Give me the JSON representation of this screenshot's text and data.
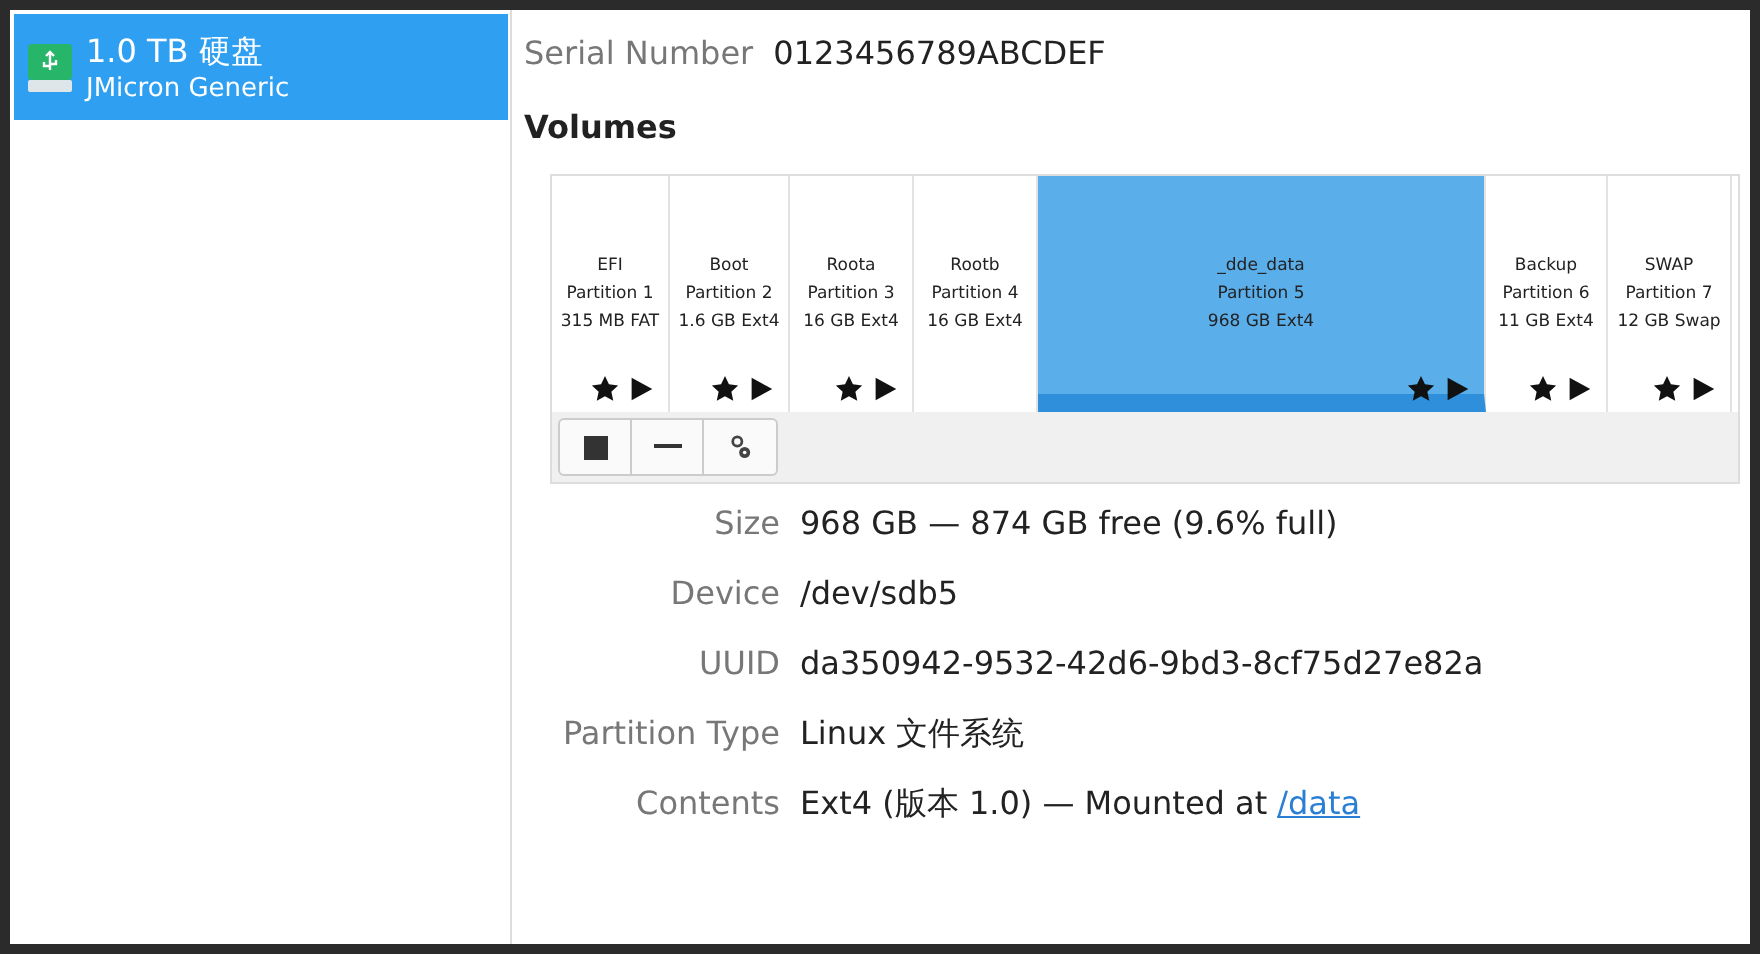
{
  "sidebar": {
    "items": [
      {
        "title": "1.0 TB 硬盘",
        "subtitle": "JMicron Generic",
        "selected": true
      }
    ]
  },
  "serial": {
    "label": "Serial Number",
    "value": "0123456789ABCDEF"
  },
  "volumes": {
    "heading": "Volumes",
    "partitions": [
      {
        "name": "EFI",
        "number": "Partition 1",
        "size": "315 MB FAT",
        "system": true,
        "mounted": true,
        "selected": false
      },
      {
        "name": "Boot",
        "number": "Partition 2",
        "size": "1.6 GB Ext4",
        "system": true,
        "mounted": true,
        "selected": false
      },
      {
        "name": "Roota",
        "number": "Partition 3",
        "size": "16 GB Ext4",
        "system": true,
        "mounted": true,
        "selected": false
      },
      {
        "name": "Rootb",
        "number": "Partition 4",
        "size": "16 GB Ext4",
        "system": false,
        "mounted": false,
        "selected": false
      },
      {
        "name": "_dde_data",
        "number": "Partition 5",
        "size": "968 GB Ext4",
        "system": true,
        "mounted": true,
        "selected": true
      },
      {
        "name": "Backup",
        "number": "Partition 6",
        "size": "11 GB Ext4",
        "system": true,
        "mounted": true,
        "selected": false
      },
      {
        "name": "SWAP",
        "number": "Partition 7",
        "size": "12 GB Swap",
        "system": true,
        "mounted": true,
        "selected": false
      }
    ]
  },
  "details": [
    {
      "label": "Size",
      "value": "968 GB — 874 GB free (9.6% full)"
    },
    {
      "label": "Device",
      "value": "/dev/sdb5"
    },
    {
      "label": "UUID",
      "value": "da350942-9532-42d6-9bd3-8cf75d27e82a"
    },
    {
      "label": "Partition Type",
      "value": "Linux 文件系统"
    },
    {
      "label": "Contents",
      "value": "Ext4 (版本 1.0) — Mounted at",
      "link": "/data"
    }
  ]
}
